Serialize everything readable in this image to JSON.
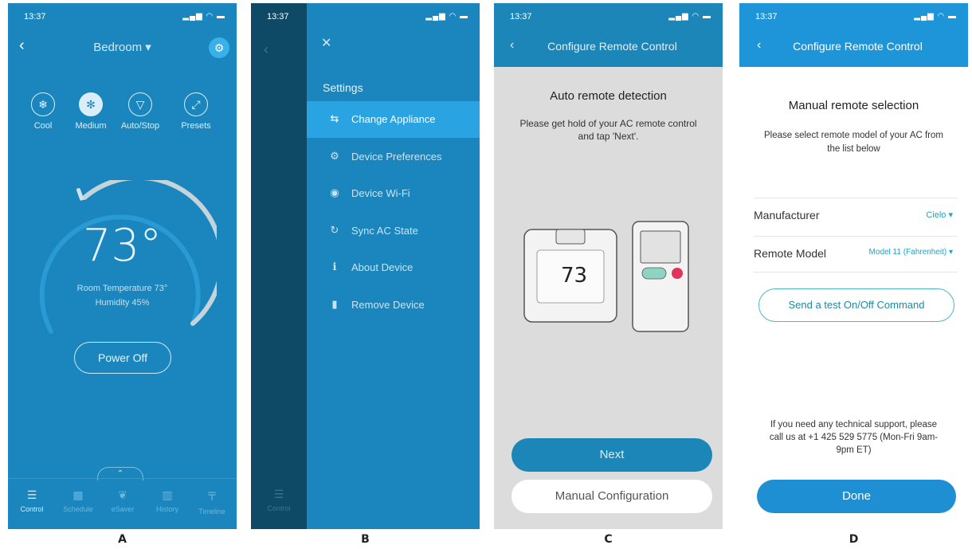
{
  "panel_labels": [
    "A",
    "B",
    "C",
    "D"
  ],
  "panelA": {
    "time": "13:37",
    "room": "Bedroom ▾",
    "modes": [
      {
        "label": "Cool",
        "icon": "❄"
      },
      {
        "label": "Medium",
        "icon": "✻"
      },
      {
        "label": "Auto/Stop",
        "icon": "▽"
      },
      {
        "label": "Presets",
        "icon": "⤢"
      }
    ],
    "temperature": "73°",
    "room_temp": "Room Temperature 73°",
    "humidity": "Humidity 45%",
    "power_button": "Power Off",
    "tabs": [
      {
        "label": "Control",
        "icon": "☰"
      },
      {
        "label": "Schedule",
        "icon": "▦"
      },
      {
        "label": "eSaver",
        "icon": "❦"
      },
      {
        "label": "History",
        "icon": "▥"
      },
      {
        "label": "Timeline",
        "icon": "〒"
      }
    ],
    "colors": {
      "background": "#1b86bd",
      "gear": "#39b0ea",
      "dial": "#c5d3da"
    }
  },
  "panelB": {
    "time": "13:37",
    "settings_title": "Settings",
    "items": [
      {
        "label": "Change Appliance",
        "icon": "⇆"
      },
      {
        "label": "Device Preferences",
        "icon": "⚙"
      },
      {
        "label": "Device Wi-Fi",
        "icon": "◉"
      },
      {
        "label": "Sync AC State",
        "icon": "↻"
      },
      {
        "label": "About Device",
        "icon": "ℹ"
      },
      {
        "label": "Remove Device",
        "icon": "▮"
      }
    ],
    "dim_tab": "Control",
    "colors": {
      "selected": "#2aa3e3"
    }
  },
  "panelC": {
    "time": "13:37",
    "header": "Configure Remote Control",
    "title": "Auto remote detection",
    "subtitle": "Please get hold of your AC remote control and tap 'Next'.",
    "display_temp": "73",
    "next_button": "Next",
    "manual_button": "Manual Configuration"
  },
  "panelD": {
    "time": "13:37",
    "header": "Configure Remote Control",
    "title": "Manual remote selection",
    "subtitle": "Please select remote model of your AC from the list below",
    "manufacturer_label": "Manufacturer",
    "manufacturer_value": "Cielo ▾",
    "model_label": "Remote Model",
    "model_value": "Model 11 (Fahrenheit) ▾",
    "test_button": "Send a test On/Off Command",
    "support": "If you need any technical support, please call us at +1 425 529 5775 (Mon-Fri 9am-9pm ET)",
    "done_button": "Done"
  }
}
